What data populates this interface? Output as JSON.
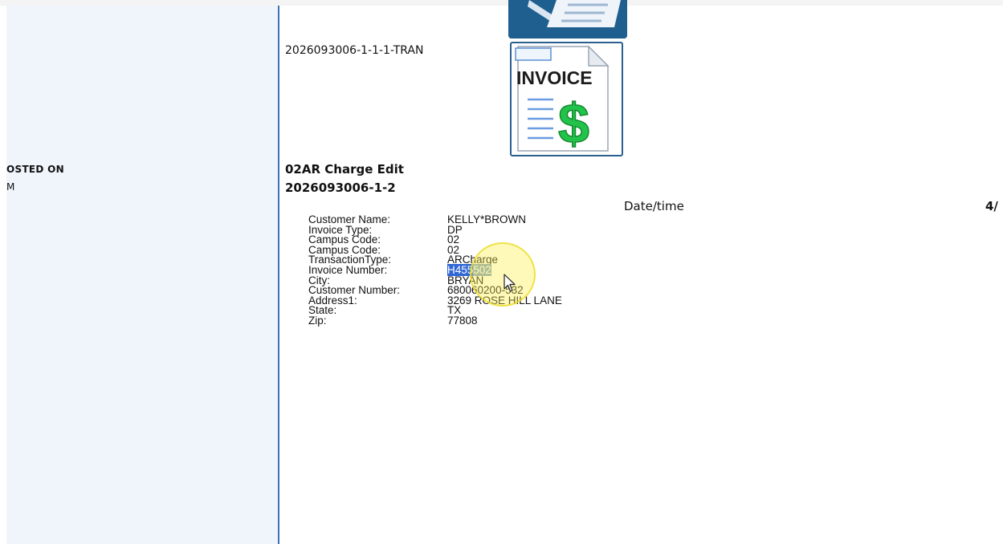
{
  "left_panel": {
    "column_header": "OSTED ON",
    "column_value": "M"
  },
  "document": {
    "transaction_id": "2026093006-1-1-1-TRAN",
    "invoice_icon_text": "INVOICE",
    "invoice_icon_symbol": "$",
    "form_title": "02AR Charge Edit",
    "form_id": "2026093006-1-2",
    "datetime_label": "Date/time",
    "page_indicator": "4/"
  },
  "fields": [
    {
      "label": "Customer Name:",
      "value": "KELLY*BROWN"
    },
    {
      "label": "Invoice Type:",
      "value": "DP"
    },
    {
      "label": "Campus Code:",
      "value": "02"
    },
    {
      "label": "Campus Code:",
      "value": "02"
    },
    {
      "label": "TransactionType:",
      "value": "ARCharge"
    },
    {
      "label": "Invoice Number:",
      "value": "H455502",
      "value_part1": "H455",
      "value_part2": "502"
    },
    {
      "label": "City:",
      "value": "BRYAN"
    },
    {
      "label": "Customer Number:",
      "value": "680060200-532"
    },
    {
      "label": "Address1:",
      "value": "3269 ROSE HILL LANE"
    },
    {
      "label": "State:",
      "value": "TX"
    },
    {
      "label": "Zip:",
      "value": "77808"
    }
  ],
  "colors": {
    "divider": "#3b73b9",
    "left_panel_bg": "#f0f4fb",
    "selection": "#2f66d6",
    "icon_dark_blue": "#1f5f8f",
    "invoice_green": "#22c34a",
    "cursor_halo": "#fff046"
  }
}
